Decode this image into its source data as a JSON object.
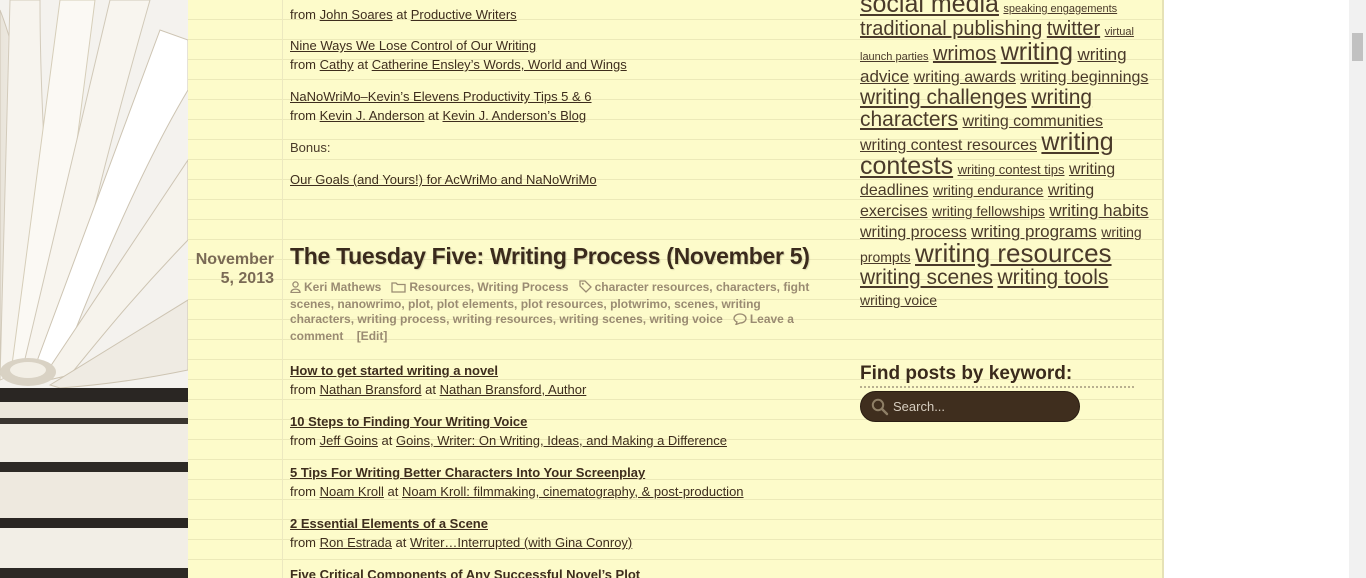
{
  "links_top": [
    {
      "title": "",
      "from_label": "from",
      "author": "John Soares",
      "at_label": "at",
      "site": "Productive Writers"
    },
    {
      "title": "Nine Ways We Lose Control of Our Writing",
      "from_label": "from",
      "author": "Cathy",
      "at_label": "at",
      "site": "Catherine Ensley’s Words, World and Wings"
    },
    {
      "title": "NaNoWriMo–Kevin’s Elevens Productivity Tips 5 & 6",
      "from_label": "from",
      "author": "Kevin J. Anderson",
      "at_label": "at",
      "site": "Kevin J. Anderson’s Blog"
    }
  ],
  "bonus_label": "Bonus:",
  "bonus_link": "Our Goals (and Yours!) for AcWriMo and NaNoWriMo",
  "post": {
    "date_line1": "November",
    "date_line2": "5, 2013",
    "title": "The Tuesday Five: Writing Process (November 5)",
    "author": "Keri Mathews",
    "categories": "Resources, Writing Process",
    "tags": "character resources, characters, fight scenes, nanowrimo, plot, plot elements, plot resources, plotwrimo, scenes, writing characters, writing process, writing resources, writing scenes, writing voice",
    "comment": "Leave a comment",
    "edit": "[Edit]"
  },
  "links_bottom": [
    {
      "title": "How to get started writing a novel",
      "from_label": "from",
      "author": "Nathan Bransford",
      "at_label": "at",
      "site": "Nathan Bransford, Author"
    },
    {
      "title": "10 Steps to Finding Your Writing Voice",
      "from_label": "from",
      "author": "Jeff Goins",
      "at_label": "at",
      "site": "Goins, Writer: On Writing, Ideas, and Making a Difference"
    },
    {
      "title": "5 Tips For Writing Better Characters Into Your Screenplay",
      "from_label": "from",
      "author": "Noam Kroll",
      "at_label": "at",
      "site": "Noam Kroll: filmmaking, cinematography, & post-production"
    },
    {
      "title": "2 Essential Elements of a Scene",
      "from_label": "from",
      "author": "Ron Estrada",
      "at_label": "at",
      "site": "Writer…Interrupted (with Gina Conroy)"
    },
    {
      "title": "Five Critical Components of Any Successful Novel’s Plot",
      "from_label": "",
      "author": "",
      "at_label": "",
      "site": ""
    }
  ],
  "tag_cloud": [
    {
      "label": "social media",
      "size": 25
    },
    {
      "label": "speaking engagements",
      "size": 11
    },
    {
      "label": "traditional publishing",
      "size": 20
    },
    {
      "label": "twitter",
      "size": 20
    },
    {
      "label": "virtual launch parties",
      "size": 11
    },
    {
      "label": "wrimos",
      "size": 20
    },
    {
      "label": "writing",
      "size": 25
    },
    {
      "label": "writing advice",
      "size": 17
    },
    {
      "label": "writing awards",
      "size": 16
    },
    {
      "label": "writing beginnings",
      "size": 16
    },
    {
      "label": "writing challenges",
      "size": 21
    },
    {
      "label": "writing characters",
      "size": 21
    },
    {
      "label": "writing communities",
      "size": 16
    },
    {
      "label": "writing contest resources",
      "size": 16
    },
    {
      "label": "writing contests",
      "size": 25
    },
    {
      "label": "writing contest tips",
      "size": 13
    },
    {
      "label": "writing deadlines",
      "size": 16
    },
    {
      "label": "writing endurance",
      "size": 14
    },
    {
      "label": "writing exercises",
      "size": 16
    },
    {
      "label": "writing fellowships",
      "size": 14
    },
    {
      "label": "writing habits",
      "size": 17
    },
    {
      "label": "writing process",
      "size": 16
    },
    {
      "label": "writing programs",
      "size": 17
    },
    {
      "label": "writing prompts",
      "size": 14
    },
    {
      "label": "writing resources",
      "size": 26
    },
    {
      "label": "writing scenes",
      "size": 21
    },
    {
      "label": "writing tools",
      "size": 21
    },
    {
      "label": "writing voice",
      "size": 14
    }
  ],
  "find_title": "Find posts by keyword:",
  "search": {
    "placeholder": "Search..."
  },
  "colors": {
    "page_bg": "#fdfbca",
    "text": "#3e2d1d",
    "search_bg": "#3f2e1e",
    "meta": "#9a8b72"
  }
}
